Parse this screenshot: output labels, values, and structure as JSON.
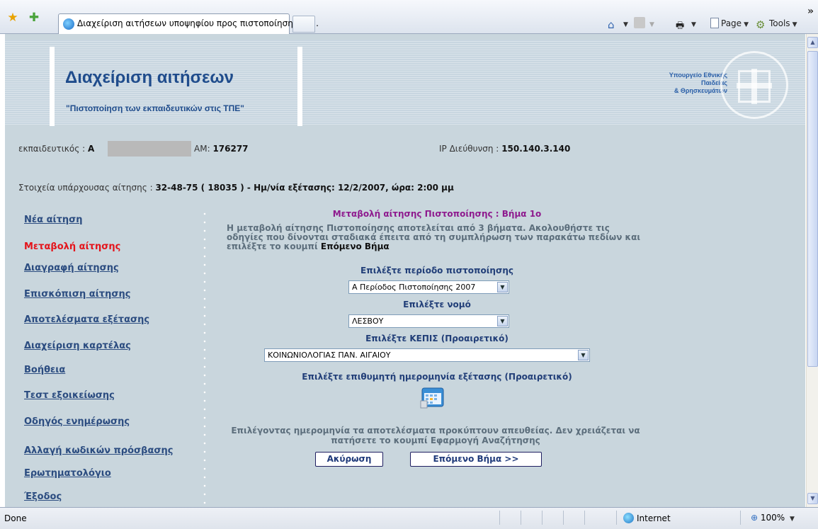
{
  "browser": {
    "tab_title": "Διαχείριση αιτήσεων υποψηφίου προς πιστοποίηση εκπ...",
    "commands": {
      "page": "Page",
      "tools": "Tools"
    },
    "status": "Done",
    "zone": "Internet",
    "zoom": "100%"
  },
  "header": {
    "title": "Διαχείριση αιτήσεων",
    "subtitle": "\"Πιστοποίηση των εκπαιδευτικών στις ΤΠΕ\"",
    "ministry_lines": [
      "Υπουργείο Εθνικής",
      "Παιδείας",
      "& Θρησκευμάτων"
    ]
  },
  "user": {
    "teacher_label": "εκπαιδευτικός :",
    "teacher_initial": "Α",
    "am_label": "ΑΜ:",
    "am_value": "176277",
    "ip_label": "IP Διεύθυνση :",
    "ip_value": "150.140.3.140",
    "app_label": "Στοιχεία υπάρχουσας αίτησης :",
    "app_value": "32-48-75 ( 18035 ) - Ημ/νία εξέτασης: 12/2/2007, ώρα: 2:00 μμ"
  },
  "sidebar": {
    "items": [
      {
        "label": "Νέα αίτηση",
        "active": false
      },
      {
        "label": "Μεταβολή αίτησης",
        "active": true
      },
      {
        "label": "Διαγραφή αίτησης",
        "active": false
      },
      {
        "label": "Επισκόπιση αίτησης",
        "active": false
      },
      {
        "label": "Αποτελέσματα εξέτασης",
        "active": false
      },
      {
        "label": "Διαχείριση καρτέλας",
        "active": false
      },
      {
        "label": "Βοήθεια",
        "active": false
      },
      {
        "label": "Τεστ εξοικείωσης",
        "active": false
      },
      {
        "label": "Οδηγός ενημέρωσης",
        "active": false
      },
      {
        "label": "Αλλαγή κωδικών πρόσβασης",
        "active": false
      },
      {
        "label": "Ερωτηματολόγιο",
        "active": false
      },
      {
        "label": "Έξοδος",
        "active": false
      }
    ]
  },
  "form": {
    "step_title": "Μεταβολή αίτησης Πιστοποίησης : Βήμα 1ο",
    "intro_text": "Η μεταβολή αίτησης Πιστοποίησης αποτελείται από 3 βήματα. Ακολουθήστε τις οδηγίες που δίνονται σταδιακά έπειτα από τη συμπλήρωση των παρακάτω πεδίων και επιλέξτε το κουμπί",
    "intro_bold": "Επόμενο Βήμα",
    "period_label": "Επιλέξτε περίοδο πιστοποίησης",
    "period_value": "Α Περίοδος Πιστοποίησης 2007",
    "prefecture_label": "Επιλέξτε νομό",
    "prefecture_value": "ΛΕΣΒΟΥ",
    "kepis_label": "Επιλέξτε ΚΕΠΙΣ (Προαιρετικό)",
    "kepis_value": "ΚΟΙΝΩΝΙΟΛΟΓΙΑΣ ΠΑΝ. ΑΙΓΑΙΟΥ",
    "date_label": "Επιλέξτε επιθυμητή ημερομηνία εξέτασης (Προαιρετικό)",
    "note": "Επιλέγοντας ημερομηνία τα αποτελέσματα προκύπτουν απευθείας. Δεν χρειάζεται να πατήσετε το κουμπί Εφαρμογή Αναζήτησης",
    "cancel_label": "Ακύρωση",
    "next_label": "Επόμενο Βήμα >>"
  },
  "colors": {
    "page_bg": "#c9d6dd",
    "title_blue": "#1f4c8c",
    "nav_link": "#2b4c80",
    "nav_active": "#e4141b",
    "step_title": "#8e1a8e"
  }
}
